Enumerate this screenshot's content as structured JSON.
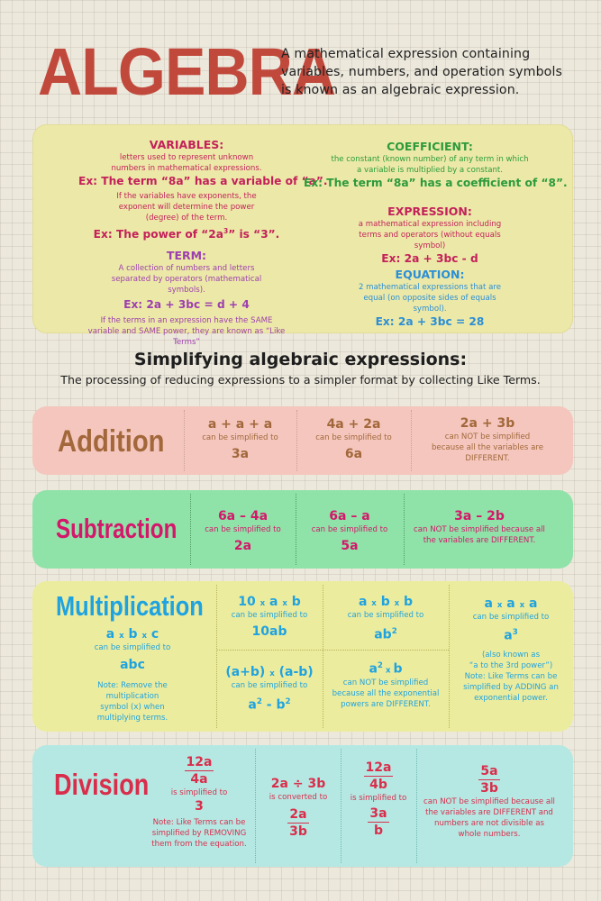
{
  "header": {
    "title": "ALGEBRA",
    "intro": "A mathematical expression containing variables, numbers, and operation symbols is known as an algebraic expression."
  },
  "definitions": {
    "variables": {
      "heading": "VARIABLES:",
      "text1": "letters used to represent unknown numbers in mathematical expressions.",
      "example1": "Ex: The term “8a” has a variable of “a”.",
      "text2": "If the variables have exponents, the exponent will determine the power (degree) of the term.",
      "example2_prefix": "Ex: The power of “2a",
      "example2_exp": "3",
      "example2_suffix": "” is “3”."
    },
    "term": {
      "heading": "TERM:",
      "text1": "A collection of numbers and letters separated by operators (mathematical symbols).",
      "example": "Ex: 2a + 3bc = d + 4",
      "text2": "If the terms in an expression have the SAME variable and SAME power, they are known as “Like Terms”"
    },
    "coefficient": {
      "heading": "COEFFICIENT:",
      "text": "the constant (known number) of any term in which a variable is multiplied by a constant.",
      "example": "Ex: The term “8a” has a coefficient of “8”."
    },
    "expression": {
      "heading": "EXPRESSION:",
      "text": "a mathematical expression including terms and operators (without equals symbol)",
      "example": "Ex: 2a + 3bc - d"
    },
    "equation": {
      "heading": "EQUATION:",
      "text": "2 mathematical expressions that are equal (on opposite sides of equals symbol).",
      "example": "Ex: 2a + 3bc = 28"
    }
  },
  "simplifying": {
    "title": "Simplifying algebraic expressions:",
    "subtitle": "The processing of reducing expressions to a simpler format by collecting Like Terms."
  },
  "addition": {
    "label": "Addition",
    "c1": {
      "expr": "a + a + a",
      "note": "can be simplified to",
      "result": "3a"
    },
    "c2": {
      "expr": "4a + 2a",
      "note": "can be simplified to",
      "result": "6a"
    },
    "c3": {
      "expr": "2a + 3b",
      "note": "can NOT be simplified because all the variables are DIFFERENT."
    }
  },
  "subtraction": {
    "label": "Subtraction",
    "c1": {
      "expr": "6a – 4a",
      "note": "can be simplified to",
      "result": "2a"
    },
    "c2": {
      "expr": "6a – a",
      "note": "can be simplified to",
      "result": "5a"
    },
    "c3": {
      "expr": "3a – 2b",
      "note": "can NOT be simplified because all the variables are DIFFERENT."
    }
  },
  "multiplication": {
    "label": "Multiplication",
    "left": {
      "expr_parts": [
        "a",
        "b",
        "c"
      ],
      "note": "can be simplified to",
      "result": "abc",
      "remark": "Note: Remove the multiplication symbol (x) when multiplying terms."
    },
    "c1": {
      "expr_parts": [
        "10",
        "a",
        "b"
      ],
      "note": "can be simplified to",
      "result": "10ab"
    },
    "c2": {
      "expr_parts": [
        "a",
        "b",
        "b"
      ],
      "note": "can be simplified to",
      "result_base": "ab",
      "result_exp": "2"
    },
    "c3": {
      "expr_parts": [
        "(a+b)",
        "(a-b)"
      ],
      "note": "can be simplified to",
      "result_a": "a",
      "result_a_exp": "2",
      "result_mid": " - ",
      "result_b": "b",
      "result_b_exp": "2"
    },
    "c4": {
      "base1": "a",
      "exp1": "2",
      "sym": " x ",
      "base2": "b",
      "note": "can NOT be simplified because all the exponential powers are DIFFERENT."
    },
    "right": {
      "expr_parts": [
        "a",
        "a",
        "a"
      ],
      "note": "can be simplified to",
      "result_base": "a",
      "result_exp": "3",
      "aka1": "(also known as",
      "aka2": "“a to the 3rd power”)",
      "remark": "Note: Like Terms can be simplified by ADDING an exponential power."
    },
    "times_symbol": "x"
  },
  "division": {
    "label": "Division",
    "c1": {
      "num": "12a",
      "den": "4a",
      "note": "is simplified to",
      "result": "3",
      "remark": "Note: Like Terms can be simplified by REMOVING them from the equation."
    },
    "c2": {
      "expr": "2a ÷ 3b",
      "note": "is converted to",
      "num": "2a",
      "den": "3b"
    },
    "c3": {
      "num": "12a",
      "den": "4b",
      "note": "is simplified to",
      "rnum": "3a",
      "rden": "b"
    },
    "c4": {
      "num": "5a",
      "den": "3b",
      "note": "can NOT be simplified because all the variables are DIFFERENT and numbers are not divisible as whole numbers."
    }
  },
  "colors": {
    "title": "#c0493c",
    "defs_bg": "#ece9a8",
    "addition_bg": "#f4c6bd",
    "addition_text": "#a2683b",
    "subtraction_bg": "#8fe3a8",
    "subtraction_text": "#d4176b",
    "multiplication_bg": "#ecec9e",
    "multiplication_text": "#1fa3e0",
    "division_bg": "#b5e8e3",
    "division_text": "#d92e4b"
  }
}
